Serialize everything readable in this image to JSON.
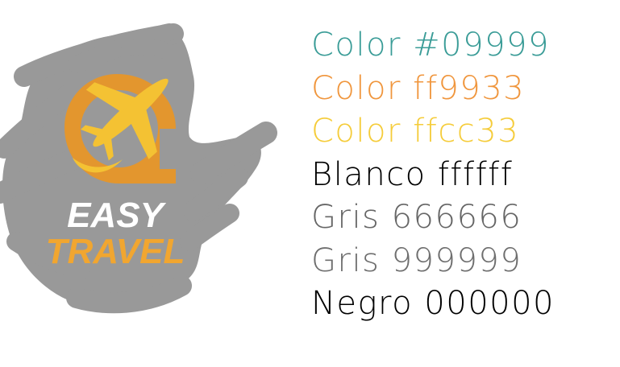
{
  "logo": {
    "brand_line_1": "EASY",
    "brand_line_2": "TRAVEL",
    "colors": {
      "scribble": "#999999",
      "pin": "#e3962e",
      "plane": "#f4c233",
      "word_easy": "#ffffff",
      "word_travel": "#f1a630"
    },
    "icons": [
      "map-pin-icon",
      "airplane-icon",
      "swoosh-icon"
    ]
  },
  "palette": [
    {
      "label": "Color #09999",
      "color": "#3a9c97"
    },
    {
      "label": "Color ff9933",
      "color": "#f0963d"
    },
    {
      "label": "Color ffcc33",
      "color": "#f5cc3a"
    },
    {
      "label": "Blanco ffffff",
      "color": "#000000"
    },
    {
      "label": "Gris 666666",
      "color": "#666666"
    },
    {
      "label": "Gris 999999",
      "color": "#6e6e6e"
    },
    {
      "label": "Negro 000000",
      "color": "#000000"
    }
  ]
}
